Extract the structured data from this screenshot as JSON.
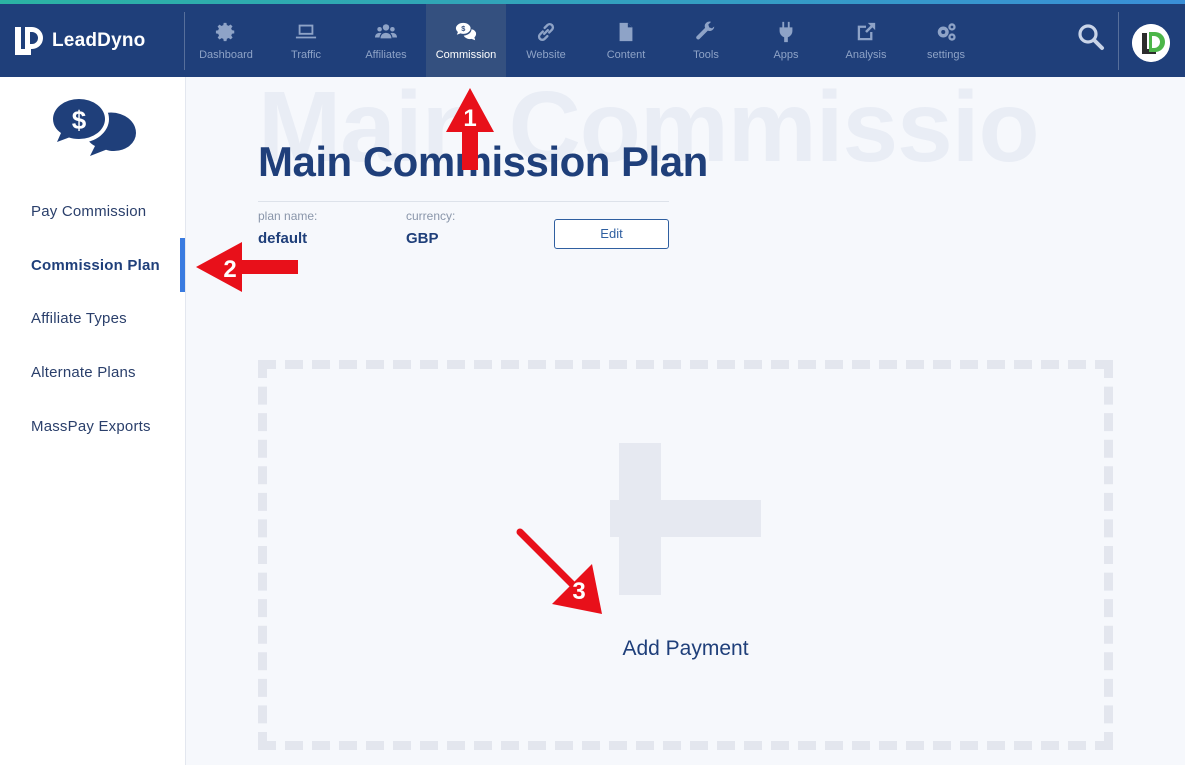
{
  "app": {
    "brand_name": "LeadDyno"
  },
  "nav": {
    "items": [
      {
        "label": "Dashboard",
        "icon": "gear-icon"
      },
      {
        "label": "Traffic",
        "icon": "laptop-icon"
      },
      {
        "label": "Affiliates",
        "icon": "users-icon"
      },
      {
        "label": "Commission",
        "icon": "money-chat-icon",
        "active": true
      },
      {
        "label": "Website",
        "icon": "link-icon"
      },
      {
        "label": "Content",
        "icon": "file-icon"
      },
      {
        "label": "Tools",
        "icon": "wrench-icon"
      },
      {
        "label": "Apps",
        "icon": "plug-icon"
      },
      {
        "label": "Analysis",
        "icon": "external-link-icon"
      },
      {
        "label": "settings",
        "icon": "gears-icon"
      }
    ]
  },
  "sidebar": {
    "items": [
      {
        "label": "Pay Commission"
      },
      {
        "label": "Commission Plan",
        "active": true
      },
      {
        "label": "Affiliate Types"
      },
      {
        "label": "Alternate Plans"
      },
      {
        "label": "MassPay Exports"
      }
    ]
  },
  "main": {
    "watermark": "Main Commissio",
    "title": "Main Commission Plan",
    "plan_name_label": "plan name:",
    "plan_name_value": "default",
    "currency_label": "currency:",
    "currency_value": "GBP",
    "edit_label": "Edit",
    "add_payment_label": "Add Payment"
  },
  "annotations": {
    "callout_1": "1",
    "callout_2": "2",
    "callout_3": "3",
    "arrow_color": "#e8101a"
  },
  "colors": {
    "nav_bg": "#1f3f7a",
    "accent": "#3a7be0",
    "text_dark": "#1f3f7a"
  }
}
